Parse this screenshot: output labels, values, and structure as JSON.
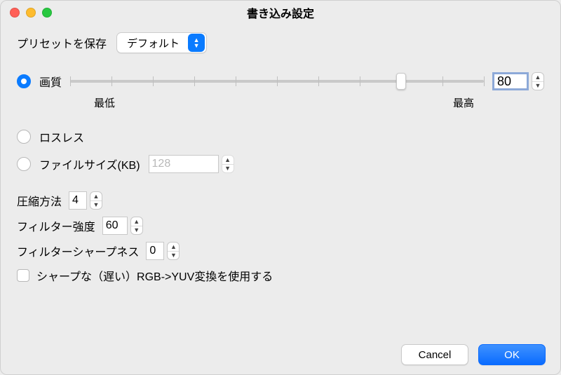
{
  "window": {
    "title": "書き込み設定"
  },
  "preset": {
    "label": "プリセットを保存",
    "value": "デフォルト"
  },
  "mode": {
    "quality": {
      "label": "画質",
      "value": "80",
      "slider_pos_pct": 80,
      "min_label": "最低",
      "max_label": "最高"
    },
    "lossless": {
      "label": "ロスレス"
    },
    "filesize": {
      "label": "ファイルサイズ(KB)",
      "value": "128"
    }
  },
  "compression": {
    "label": "圧縮方法",
    "value": "4"
  },
  "filter_strength": {
    "label": "フィルター強度",
    "value": "60"
  },
  "filter_sharpness": {
    "label": "フィルターシャープネス",
    "value": "0"
  },
  "sharp_yuv": {
    "label": "シャープな（遅い）RGB->YUV変換を使用する"
  },
  "buttons": {
    "cancel": "Cancel",
    "ok": "OK"
  }
}
